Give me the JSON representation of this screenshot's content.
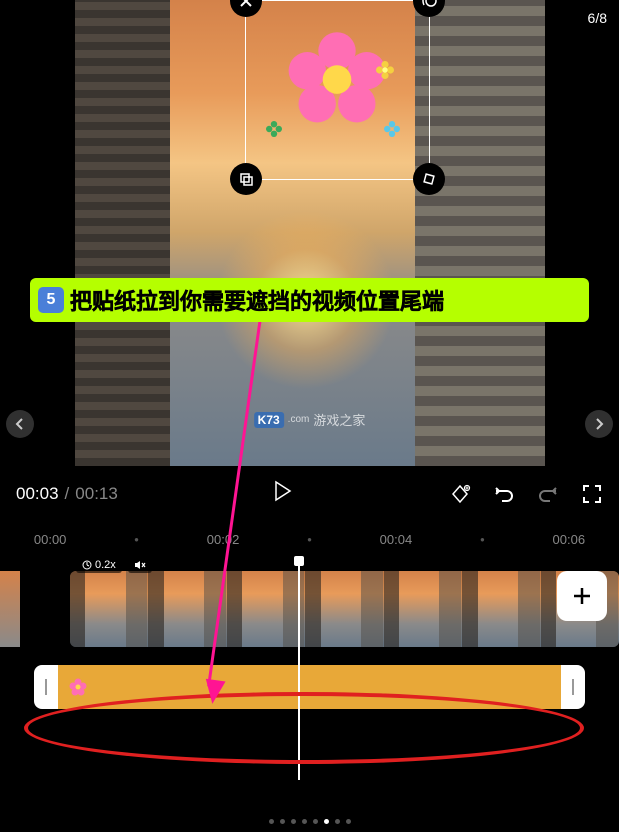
{
  "page_counter": "6/8",
  "instruction": {
    "step": "5",
    "text": "把贴纸拉到你需要遮挡的视频位置尾端"
  },
  "watermark": {
    "badge": "K73",
    "suffix": "游戏之家",
    "domain": ".com"
  },
  "time": {
    "current": "00:03",
    "separator": "/",
    "total": "00:13"
  },
  "ruler": {
    "t0": "00:00",
    "t1": "00:02",
    "t2": "00:04",
    "t3": "00:06"
  },
  "clip": {
    "speed": "0.2x"
  },
  "icons": {
    "close": "close-icon",
    "motion": "motion-icon",
    "copy": "copy-icon",
    "rotate": "rotate-icon",
    "prev": "chevron-left-icon",
    "next": "chevron-right-icon",
    "play": "play-icon",
    "keyframe": "keyframe-icon",
    "undo": "undo-icon",
    "redo": "redo-icon",
    "fullscreen": "fullscreen-icon",
    "timer": "timer-icon",
    "mute": "mute-icon",
    "add": "add-icon"
  },
  "colors": {
    "accent_green": "#b5ff00",
    "step_blue": "#4a7fd8",
    "arrow_pink": "#ff1493",
    "sticker_orange": "#e8a838",
    "highlight_red": "#e02020"
  },
  "dots": {
    "total": 8,
    "active_index": 5
  }
}
